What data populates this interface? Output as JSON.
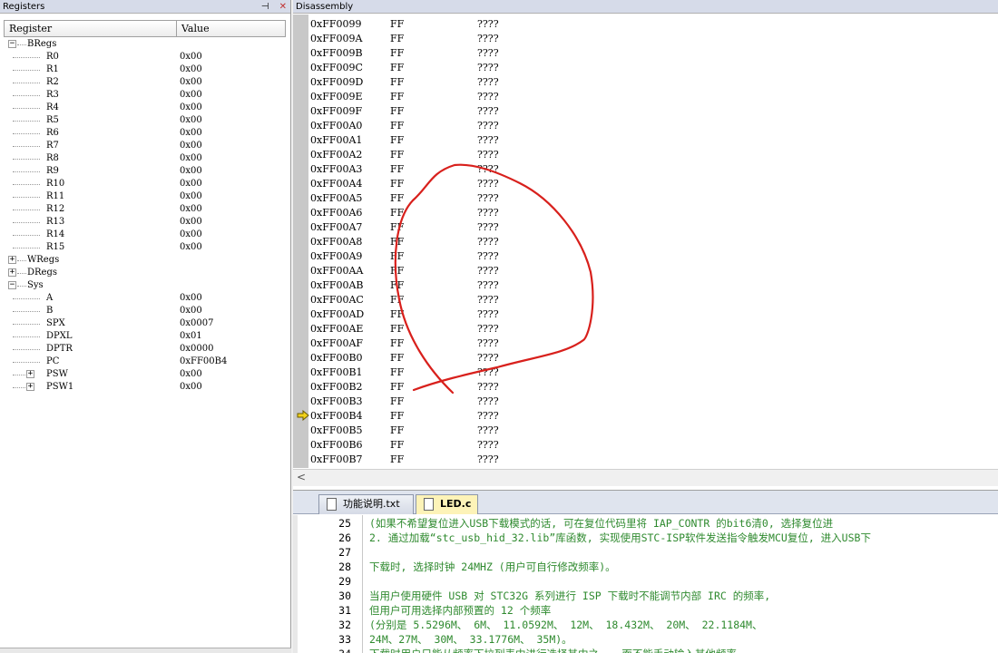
{
  "registers": {
    "title": "Registers",
    "pin_glyph": "⊣",
    "close_glyph": "✕",
    "col_register": "Register",
    "col_value": "Value",
    "rows": [
      {
        "name": "BRegs",
        "value": "",
        "level": 0,
        "expander": "−"
      },
      {
        "name": "R0",
        "value": "0x00",
        "level": 1,
        "expander": ""
      },
      {
        "name": "R1",
        "value": "0x00",
        "level": 1,
        "expander": ""
      },
      {
        "name": "R2",
        "value": "0x00",
        "level": 1,
        "expander": ""
      },
      {
        "name": "R3",
        "value": "0x00",
        "level": 1,
        "expander": ""
      },
      {
        "name": "R4",
        "value": "0x00",
        "level": 1,
        "expander": ""
      },
      {
        "name": "R5",
        "value": "0x00",
        "level": 1,
        "expander": ""
      },
      {
        "name": "R6",
        "value": "0x00",
        "level": 1,
        "expander": ""
      },
      {
        "name": "R7",
        "value": "0x00",
        "level": 1,
        "expander": ""
      },
      {
        "name": "R8",
        "value": "0x00",
        "level": 1,
        "expander": ""
      },
      {
        "name": "R9",
        "value": "0x00",
        "level": 1,
        "expander": ""
      },
      {
        "name": "R10",
        "value": "0x00",
        "level": 1,
        "expander": ""
      },
      {
        "name": "R11",
        "value": "0x00",
        "level": 1,
        "expander": ""
      },
      {
        "name": "R12",
        "value": "0x00",
        "level": 1,
        "expander": ""
      },
      {
        "name": "R13",
        "value": "0x00",
        "level": 1,
        "expander": ""
      },
      {
        "name": "R14",
        "value": "0x00",
        "level": 1,
        "expander": ""
      },
      {
        "name": "R15",
        "value": "0x00",
        "level": 1,
        "expander": ""
      },
      {
        "name": "WRegs",
        "value": "",
        "level": 0,
        "expander": "+"
      },
      {
        "name": "DRegs",
        "value": "",
        "level": 0,
        "expander": "+"
      },
      {
        "name": "Sys",
        "value": "",
        "level": 0,
        "expander": "−"
      },
      {
        "name": "A",
        "value": "0x00",
        "level": 1,
        "expander": ""
      },
      {
        "name": "B",
        "value": "0x00",
        "level": 1,
        "expander": ""
      },
      {
        "name": "SPX",
        "value": "0x0007",
        "level": 1,
        "expander": ""
      },
      {
        "name": "DPXL",
        "value": "0x01",
        "level": 1,
        "expander": ""
      },
      {
        "name": "DPTR",
        "value": "0x0000",
        "level": 1,
        "expander": ""
      },
      {
        "name": "PC",
        "value": "0xFF00B4",
        "level": 1,
        "expander": ""
      },
      {
        "name": "PSW",
        "value": "0x00",
        "level": 1,
        "expander": "+"
      },
      {
        "name": "PSW1",
        "value": "0x00",
        "level": 1,
        "expander": "+"
      }
    ]
  },
  "disassembly": {
    "title": "Disassembly",
    "scroll_left_glyph": "<",
    "current_line_index": 27,
    "lines": [
      {
        "addr": "0xFF0099",
        "opcode": "FF",
        "mnemonic": "????"
      },
      {
        "addr": "0xFF009A",
        "opcode": "FF",
        "mnemonic": "????"
      },
      {
        "addr": "0xFF009B",
        "opcode": "FF",
        "mnemonic": "????"
      },
      {
        "addr": "0xFF009C",
        "opcode": "FF",
        "mnemonic": "????"
      },
      {
        "addr": "0xFF009D",
        "opcode": "FF",
        "mnemonic": "????"
      },
      {
        "addr": "0xFF009E",
        "opcode": "FF",
        "mnemonic": "????"
      },
      {
        "addr": "0xFF009F",
        "opcode": "FF",
        "mnemonic": "????"
      },
      {
        "addr": "0xFF00A0",
        "opcode": "FF",
        "mnemonic": "????"
      },
      {
        "addr": "0xFF00A1",
        "opcode": "FF",
        "mnemonic": "????"
      },
      {
        "addr": "0xFF00A2",
        "opcode": "FF",
        "mnemonic": "????"
      },
      {
        "addr": "0xFF00A3",
        "opcode": "FF",
        "mnemonic": "????"
      },
      {
        "addr": "0xFF00A4",
        "opcode": "FF",
        "mnemonic": "????"
      },
      {
        "addr": "0xFF00A5",
        "opcode": "FF",
        "mnemonic": "????"
      },
      {
        "addr": "0xFF00A6",
        "opcode": "FF",
        "mnemonic": "????"
      },
      {
        "addr": "0xFF00A7",
        "opcode": "FF",
        "mnemonic": "????"
      },
      {
        "addr": "0xFF00A8",
        "opcode": "FF",
        "mnemonic": "????"
      },
      {
        "addr": "0xFF00A9",
        "opcode": "FF",
        "mnemonic": "????"
      },
      {
        "addr": "0xFF00AA",
        "opcode": "FF",
        "mnemonic": "????"
      },
      {
        "addr": "0xFF00AB",
        "opcode": "FF",
        "mnemonic": "????"
      },
      {
        "addr": "0xFF00AC",
        "opcode": "FF",
        "mnemonic": "????"
      },
      {
        "addr": "0xFF00AD",
        "opcode": "FF",
        "mnemonic": "????"
      },
      {
        "addr": "0xFF00AE",
        "opcode": "FF",
        "mnemonic": "????"
      },
      {
        "addr": "0xFF00AF",
        "opcode": "FF",
        "mnemonic": "????"
      },
      {
        "addr": "0xFF00B0",
        "opcode": "FF",
        "mnemonic": "????"
      },
      {
        "addr": "0xFF00B1",
        "opcode": "FF",
        "mnemonic": "????"
      },
      {
        "addr": "0xFF00B2",
        "opcode": "FF",
        "mnemonic": "????"
      },
      {
        "addr": "0xFF00B3",
        "opcode": "FF",
        "mnemonic": "????"
      },
      {
        "addr": "0xFF00B4",
        "opcode": "FF",
        "mnemonic": "????"
      },
      {
        "addr": "0xFF00B5",
        "opcode": "FF",
        "mnemonic": "????"
      },
      {
        "addr": "0xFF00B6",
        "opcode": "FF",
        "mnemonic": "????"
      },
      {
        "addr": "0xFF00B7",
        "opcode": "FF",
        "mnemonic": "????"
      }
    ]
  },
  "editor": {
    "tabs": [
      {
        "label": "功能说明.txt",
        "active": false
      },
      {
        "label": "LED.c",
        "active": true
      }
    ],
    "lines": [
      {
        "num": "25",
        "text": "   (如果不希望复位进入USB下载模式的话, 可在复位代码里将 IAP_CONTR 的bit6清0, 选择复位进"
      },
      {
        "num": "26",
        "text": "2. 通过加载“stc_usb_hid_32.lib”库函数, 实现使用STC-ISP软件发送指令触发MCU复位, 进入USB下"
      },
      {
        "num": "27",
        "text": ""
      },
      {
        "num": "28",
        "text": "下载时, 选择时钟 24MHZ (用户可自行修改频率)。"
      },
      {
        "num": "29",
        "text": ""
      },
      {
        "num": "30",
        "text": "当用户使用硬件 USB 对 STC32G 系列进行 ISP 下载时不能调节内部 IRC 的频率,"
      },
      {
        "num": "31",
        "text": "但用户可用选择内部预置的 12 个频率"
      },
      {
        "num": "32",
        "text": "(分别是 5.5296M、 6M、 11.0592M、 12M、 18.432M、 20M、 22.1184M、"
      },
      {
        "num": "33",
        "text": "24M、27M、 30M、 33.1776M、 35M)。"
      },
      {
        "num": "34",
        "text": "下载时用户只能从频率下拉列表中进行选择其中之一, 而不能手动输入其他频率"
      }
    ]
  },
  "colors": {
    "annotation_red": "#d8201c",
    "code_comment_green": "#2f8a2f",
    "pc_arrow_yellow": "#f2d21b",
    "active_tab": "#fdf3b8"
  }
}
